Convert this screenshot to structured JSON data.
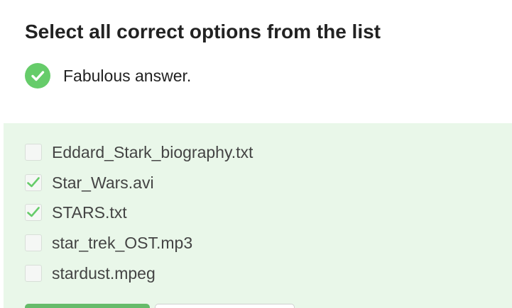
{
  "page": {
    "title": "Select all correct options from the list"
  },
  "feedback": {
    "icon": "check-circle-icon",
    "text": "Fabulous answer.",
    "color": "#66cc6a"
  },
  "options": [
    {
      "label": "Eddard_Stark_biography.txt",
      "checked": false
    },
    {
      "label": "Star_Wars.avi",
      "checked": true
    },
    {
      "label": "STARS.txt",
      "checked": true
    },
    {
      "label": "star_trek_OST.mp3",
      "checked": false
    },
    {
      "label": "stardust.mpeg",
      "checked": false
    }
  ],
  "colors": {
    "success_green": "#66cc6a",
    "panel_background": "#e9f7e9",
    "button_green": "#66bb6a"
  }
}
